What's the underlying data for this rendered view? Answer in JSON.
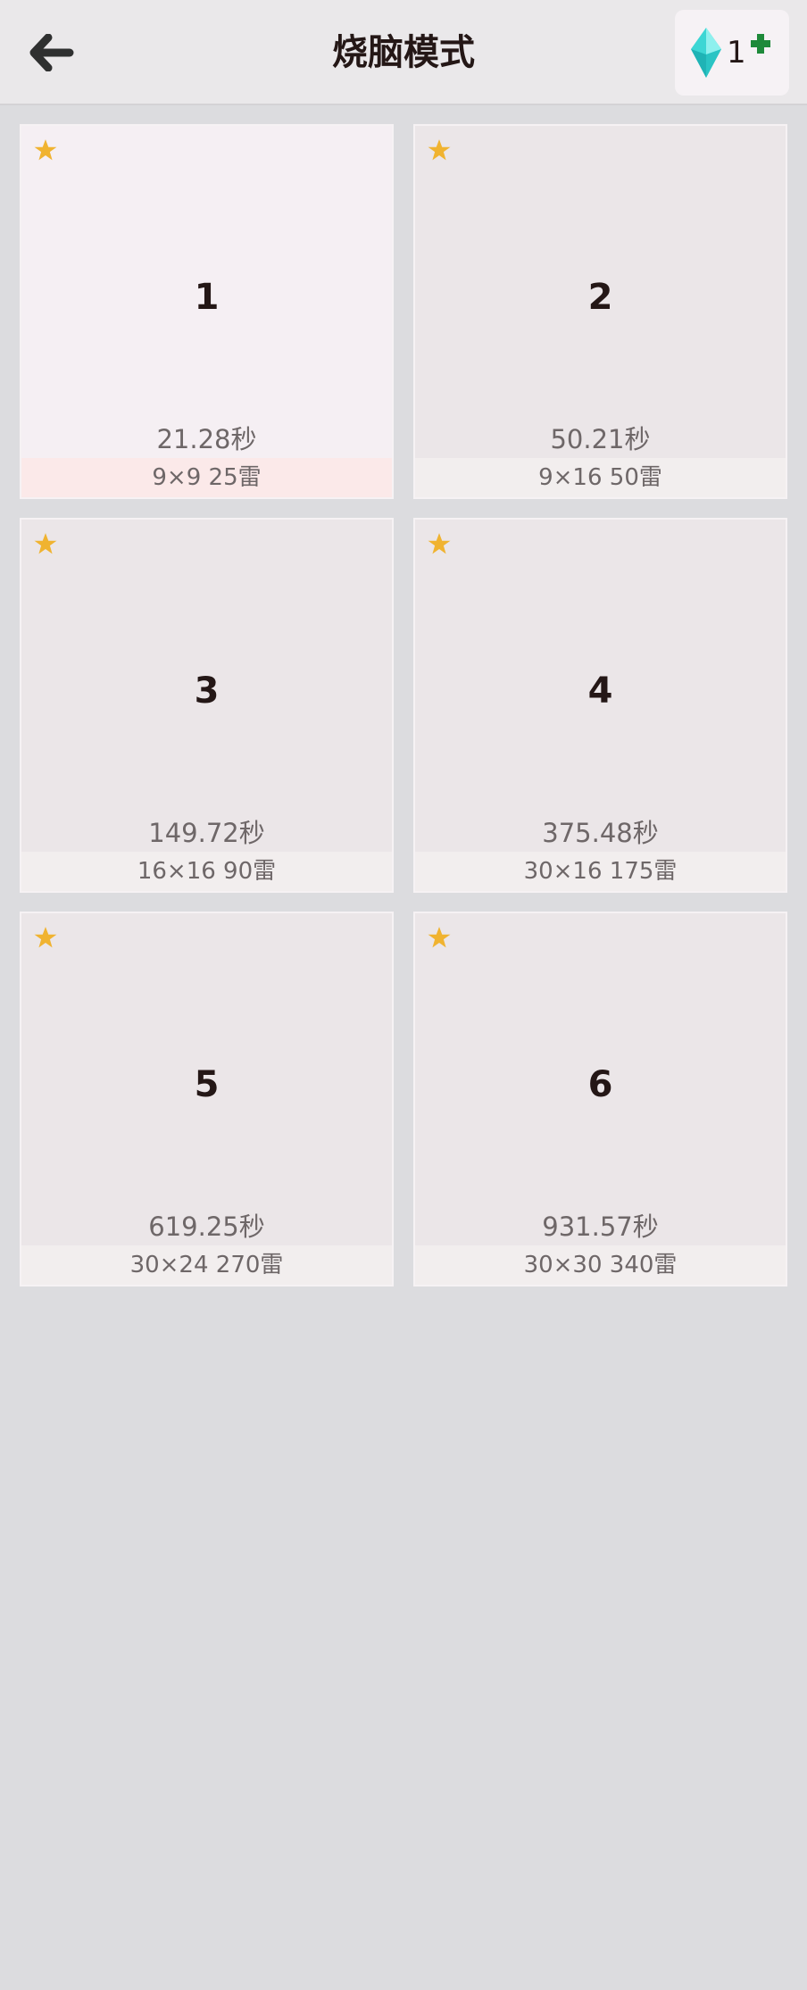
{
  "header": {
    "title": "烧脑模式",
    "back_icon": "arrow-left-icon",
    "gem_count": "1",
    "gem_icon": "diamond-icon",
    "plus_icon": "plus-icon"
  },
  "colors": {
    "star": "#f0b330",
    "gem": "#3cd6d4",
    "plus": "#1e8a3a",
    "title_text": "#241716"
  },
  "levels": [
    {
      "number": "1",
      "time": "21.28秒",
      "info": "9×9  25雷",
      "selected": true
    },
    {
      "number": "2",
      "time": "50.21秒",
      "info": "9×16  50雷",
      "selected": false
    },
    {
      "number": "3",
      "time": "149.72秒",
      "info": "16×16  90雷",
      "selected": false
    },
    {
      "number": "4",
      "time": "375.48秒",
      "info": "30×16  175雷",
      "selected": false
    },
    {
      "number": "5",
      "time": "619.25秒",
      "info": "30×24  270雷",
      "selected": false
    },
    {
      "number": "6",
      "time": "931.57秒",
      "info": "30×30  340雷",
      "selected": false
    }
  ]
}
